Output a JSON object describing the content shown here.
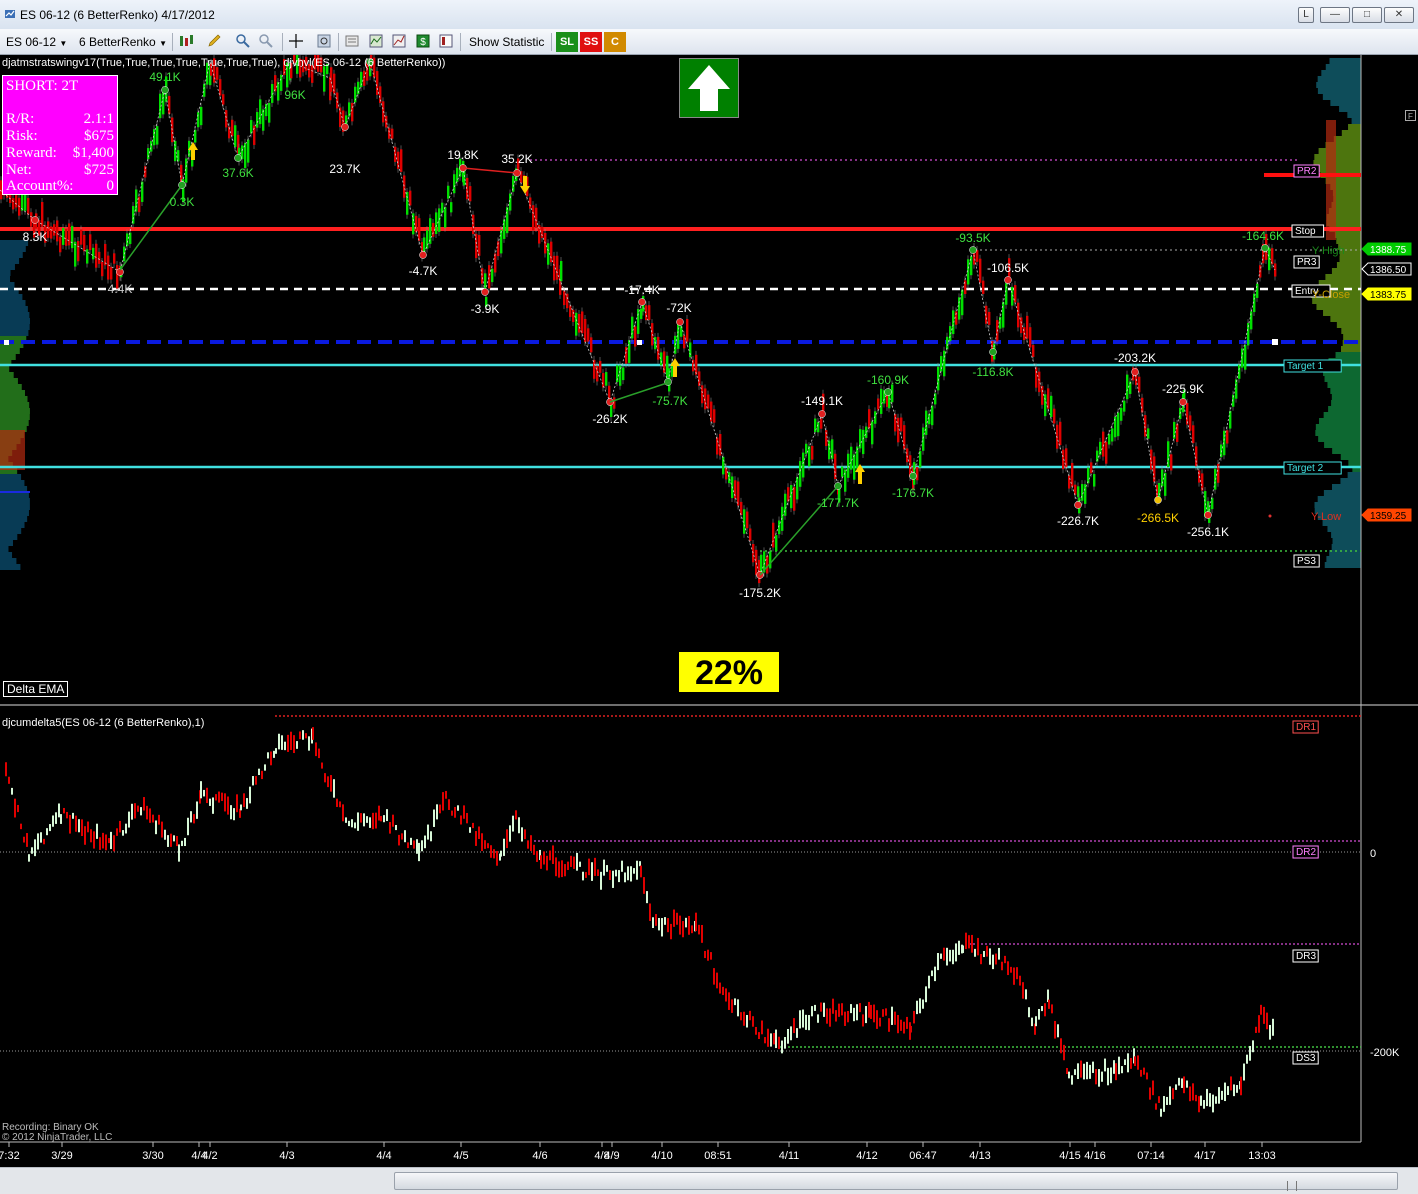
{
  "window": {
    "title": "ES 06-12 (6 BetterRenko)  4/17/2012",
    "buttons": [
      "L",
      "—",
      "□",
      "✕"
    ]
  },
  "toolbar": {
    "instrument": "ES 06-12",
    "bar_type": "6 BetterRenko",
    "show_statistic": "Show Statistic",
    "sl": "SL",
    "ss": "SS",
    "c": "C",
    "colors": {
      "sl": "#1a8f1a",
      "ss": "#e01010",
      "c": "#d18a00"
    }
  },
  "upper_panel": {
    "indicator_label": "djatmstratswingv17(True,True,True,True,True,True,True), djvhvl(ES 06-12 (6 BetterRenko))",
    "position_box": {
      "title": "SHORT: 2T",
      "rows": [
        {
          "k": "R/R:",
          "v": "2.1:1"
        },
        {
          "k": "Risk:",
          "v": "$675"
        },
        {
          "k": "Reward:",
          "v": "$1,400"
        },
        {
          "k": "Net:",
          "v": "$725"
        },
        {
          "k": "Account%:",
          "v": "0"
        }
      ]
    },
    "arrow": "up",
    "percent": "22%",
    "delta_ema": "Delta EMA",
    "level_labels": [
      "PR2",
      "Stop",
      "PR3",
      "Entry",
      "Target 1",
      "Target 2",
      "PS3"
    ],
    "side_labels": {
      "y_high": "Y-High",
      "y_close": "Y-Close",
      "y_low": "Y-Low"
    },
    "price_tags": [
      {
        "value": "1388.75",
        "color": "#00cc00"
      },
      {
        "value": "1386.50",
        "color": "#ffffff"
      },
      {
        "value": "1383.75",
        "color": "#ffff00"
      },
      {
        "value": "1359.25",
        "color": "#ff4500"
      }
    ],
    "swing_labels": [
      "8.3K",
      "4.4K",
      "49.1K",
      "0.3K",
      "37.6K",
      "96K",
      "23.7K",
      "19.8K",
      "35.2K",
      "-4.7K",
      "-3.9K",
      "-17.4K",
      "-72K",
      "-26.2K",
      "-75.7K",
      "-175.2K",
      "-149.1K",
      "-177.7K",
      "-160.9K",
      "-176.7K",
      "-93.5K",
      "-106.5K",
      "-116.8K",
      "-203.2K",
      "-226.7K",
      "-225.9K",
      "-266.5K",
      "-256.1K",
      "-164.6K"
    ]
  },
  "lower_panel": {
    "indicator_label": "djcumdelta5(ES 06-12 (6 BetterRenko),1)",
    "level_labels": [
      "DR1",
      "DR2",
      "DR3",
      "DS3"
    ],
    "axis_ticks": [
      "0",
      "-200K"
    ],
    "footer_lines": [
      "Recording: Binary OK",
      "© 2012 NinjaTrader, LLC"
    ]
  },
  "x_axis_labels": [
    "7:32",
    "3/29",
    "3/30",
    "4/4",
    "4/2",
    "4/3",
    "4/4",
    "4/5",
    "4/6",
    "4/8",
    "4/9",
    "4/10",
    "08:51",
    "4/11",
    "4/12",
    "06:47",
    "4/13",
    "4/15",
    "4/16",
    "07:14",
    "4/17",
    "13:03"
  ]
}
